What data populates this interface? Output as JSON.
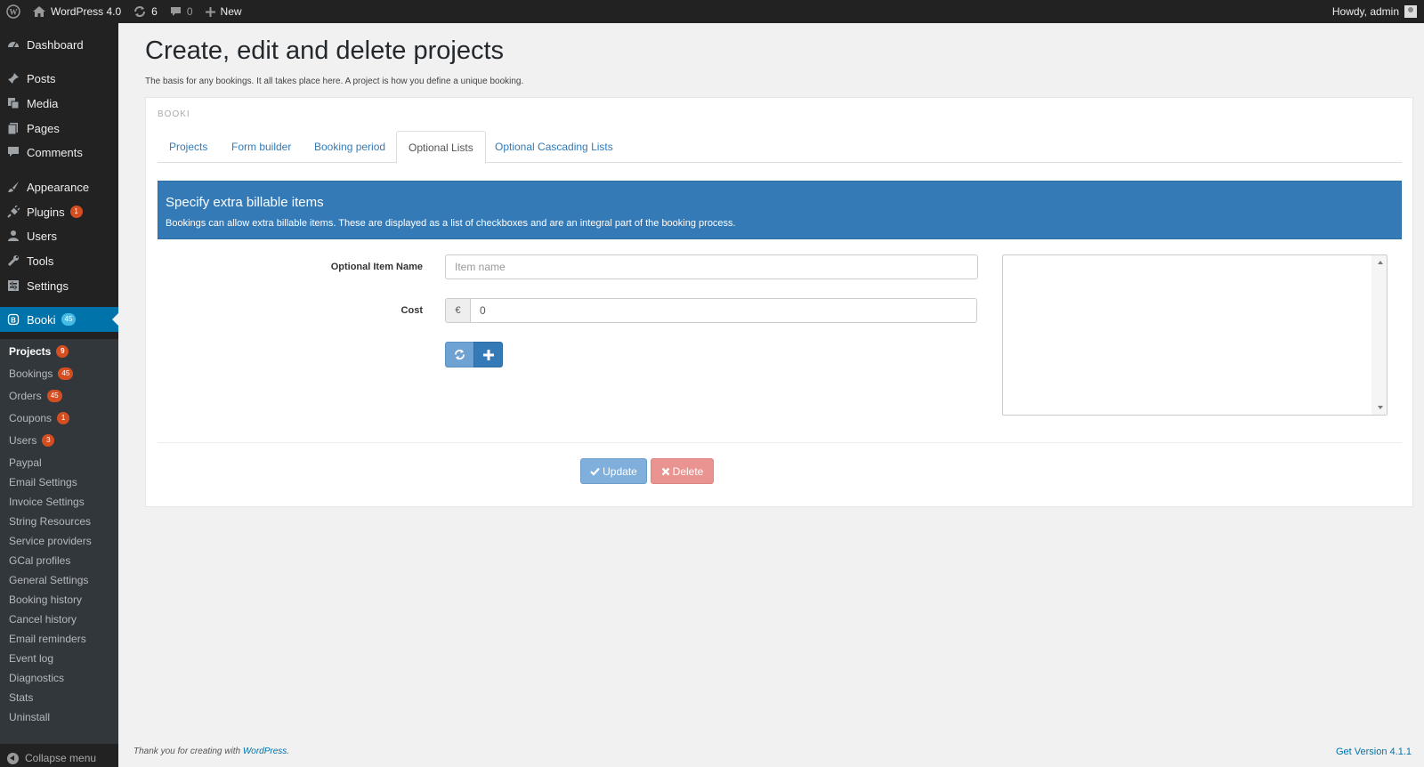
{
  "adminbar": {
    "site_name": "WordPress 4.0",
    "updates_count": "6",
    "comments_count": "0",
    "new_label": "New",
    "howdy": "Howdy, admin"
  },
  "sidebar": {
    "items": [
      {
        "label": "Dashboard",
        "icon": "dashboard-icon"
      },
      {
        "label": "Posts",
        "icon": "pin-icon"
      },
      {
        "label": "Media",
        "icon": "media-icon"
      },
      {
        "label": "Pages",
        "icon": "pages-icon"
      },
      {
        "label": "Comments",
        "icon": "comment-icon"
      },
      {
        "label": "Appearance",
        "icon": "brush-icon"
      },
      {
        "label": "Plugins",
        "icon": "plug-icon",
        "badge": "1"
      },
      {
        "label": "Users",
        "icon": "user-icon"
      },
      {
        "label": "Tools",
        "icon": "wrench-icon"
      },
      {
        "label": "Settings",
        "icon": "settings-icon"
      },
      {
        "label": "Booki",
        "icon": "booki-icon",
        "badge": "45"
      }
    ],
    "submenu": [
      {
        "label": "Projects",
        "badge": "9"
      },
      {
        "label": "Bookings",
        "badge": "45"
      },
      {
        "label": "Orders",
        "badge": "45"
      },
      {
        "label": "Coupons",
        "badge": "1"
      },
      {
        "label": "Users",
        "badge": "3"
      },
      {
        "label": "Paypal"
      },
      {
        "label": "Email Settings"
      },
      {
        "label": "Invoice Settings"
      },
      {
        "label": "String Resources"
      },
      {
        "label": "Service providers"
      },
      {
        "label": "GCal profiles"
      },
      {
        "label": "General Settings"
      },
      {
        "label": "Booking history"
      },
      {
        "label": "Cancel history"
      },
      {
        "label": "Email reminders"
      },
      {
        "label": "Event log"
      },
      {
        "label": "Diagnostics"
      },
      {
        "label": "Stats"
      },
      {
        "label": "Uninstall"
      }
    ],
    "collapse_label": "Collapse menu"
  },
  "page": {
    "title": "Create, edit and delete projects",
    "subtitle": "The basis for any bookings. It all takes place here. A project is how you define a unique booking.",
    "panel_label": "BOOKI",
    "tabs": [
      "Projects",
      "Form builder",
      "Booking period",
      "Optional Lists",
      "Optional Cascading Lists"
    ],
    "active_tab": "Optional Lists"
  },
  "info": {
    "heading": "Specify extra billable items",
    "text": "Bookings can allow extra billable items. These are displayed as a list of checkboxes and are an integral part of the booking process."
  },
  "form": {
    "item_name_label": "Optional Item Name",
    "item_name_placeholder": "Item name",
    "cost_label": "Cost",
    "currency": "€",
    "cost_value": "0"
  },
  "actions": {
    "update_label": "Update",
    "delete_label": "Delete"
  },
  "footer": {
    "thanks_prefix": "Thank you for creating with",
    "thanks_link": "WordPress",
    "thanks_suffix": ".",
    "version": "Get Version 4.1.1"
  },
  "colors": {
    "accent": "#0073aa",
    "info_blue": "#337ab7",
    "badge_orange": "#d54e21"
  }
}
